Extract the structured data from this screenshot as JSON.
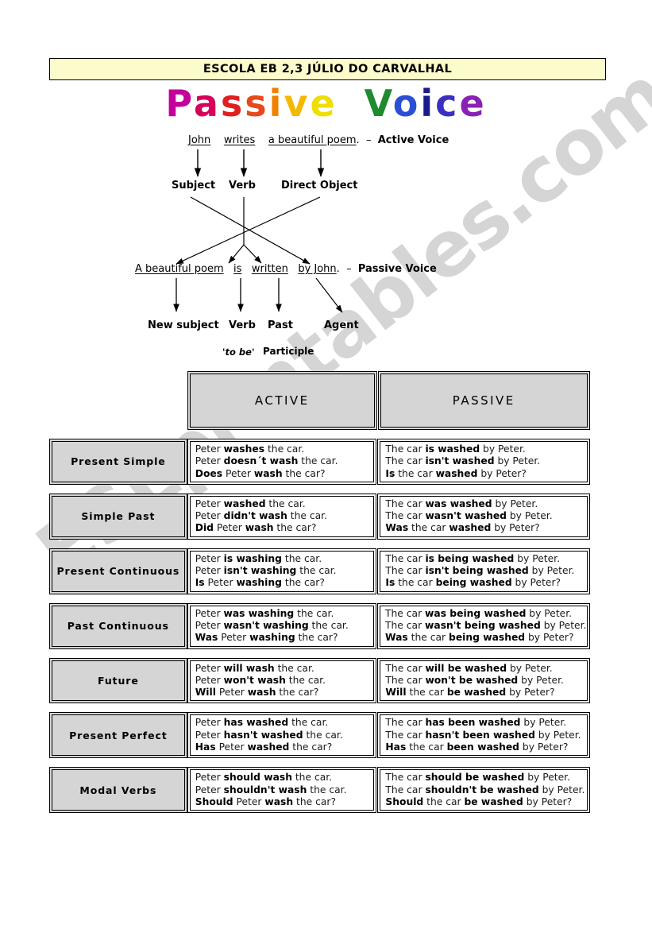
{
  "school_header": {
    "text": "ESCOLA EB 2,3 JÚLIO DO CARVALHAL"
  },
  "title": {
    "word1": "Passive",
    "word2": "Voice",
    "letters": [
      {
        "ch": "P",
        "color": "#C4009B"
      },
      {
        "ch": "a",
        "color": "#D6005B"
      },
      {
        "ch": "s",
        "color": "#E02020"
      },
      {
        "ch": "s",
        "color": "#E8491C"
      },
      {
        "ch": "i",
        "color": "#F08000"
      },
      {
        "ch": "v",
        "color": "#F5B800"
      },
      {
        "ch": "e",
        "color": "#EDE000"
      },
      {
        "ch": "V",
        "color": "#1E8B2E"
      },
      {
        "ch": "o",
        "color": "#2A4FD6"
      },
      {
        "ch": "i",
        "color": "#1B1B8F"
      },
      {
        "ch": "c",
        "color": "#3A2FC0"
      },
      {
        "ch": "e",
        "color": "#8A21B5"
      }
    ]
  },
  "watermark": {
    "text": "ESLprintables.com"
  },
  "diagram": {
    "active_sentence": {
      "part1": "John",
      "part2": "writes",
      "part3": "a beautiful poem",
      "period": ".",
      "dash": "–",
      "voice_label": "Active Voice"
    },
    "active_labels": {
      "subject": "Subject",
      "verb": "Verb",
      "direct_object": "Direct Object"
    },
    "passive_sentence": {
      "part1": "A beautiful poem",
      "part2": "is",
      "part3": "written",
      "part4": "by John",
      "period": ".",
      "dash": "–",
      "voice_label": "Passive Voice"
    },
    "passive_labels": {
      "new_subject": "New subject",
      "verb": "Verb",
      "past": "Past",
      "agent": "Agent",
      "to_be": "'to be'",
      "participle": "Participle"
    }
  },
  "table": {
    "columns": {
      "active": "ACTIVE",
      "passive": "PASSIVE"
    },
    "rows": [
      {
        "label": "Present Simple",
        "active": [
          [
            {
              "t": "Peter ",
              "b": false
            },
            {
              "t": "washes",
              "b": true
            },
            {
              "t": " the car.",
              "b": false
            }
          ],
          [
            {
              "t": "Peter ",
              "b": false
            },
            {
              "t": "doesn´t wash",
              "b": true
            },
            {
              "t": " the car.",
              "b": false
            }
          ],
          [
            {
              "t": "Does",
              "b": true
            },
            {
              "t": " Peter ",
              "b": false
            },
            {
              "t": "wash",
              "b": true
            },
            {
              "t": " the car?",
              "b": false
            }
          ]
        ],
        "passive": [
          [
            {
              "t": "The car ",
              "b": false
            },
            {
              "t": "is washed",
              "b": true
            },
            {
              "t": " by Peter.",
              "b": false
            }
          ],
          [
            {
              "t": "The car ",
              "b": false
            },
            {
              "t": "isn't washed",
              "b": true
            },
            {
              "t": " by Peter.",
              "b": false
            }
          ],
          [
            {
              "t": "Is",
              "b": true
            },
            {
              "t": " the car ",
              "b": false
            },
            {
              "t": "washed",
              "b": true
            },
            {
              "t": " by Peter?",
              "b": false
            }
          ]
        ]
      },
      {
        "label": "Simple Past",
        "active": [
          [
            {
              "t": "Peter ",
              "b": false
            },
            {
              "t": "washed",
              "b": true
            },
            {
              "t": " the car.",
              "b": false
            }
          ],
          [
            {
              "t": "Peter ",
              "b": false
            },
            {
              "t": "didn't wash",
              "b": true
            },
            {
              "t": " the car.",
              "b": false
            }
          ],
          [
            {
              "t": "Did",
              "b": true
            },
            {
              "t": " Peter ",
              "b": false
            },
            {
              "t": "wash",
              "b": true
            },
            {
              "t": " the car?",
              "b": false
            }
          ]
        ],
        "passive": [
          [
            {
              "t": "The car ",
              "b": false
            },
            {
              "t": "was washed",
              "b": true
            },
            {
              "t": " by Peter.",
              "b": false
            }
          ],
          [
            {
              "t": "The car ",
              "b": false
            },
            {
              "t": "wasn't washed",
              "b": true
            },
            {
              "t": " by Peter.",
              "b": false
            }
          ],
          [
            {
              "t": "Was",
              "b": true
            },
            {
              "t": " the car ",
              "b": false
            },
            {
              "t": "washed",
              "b": true
            },
            {
              "t": " by Peter?",
              "b": false
            }
          ]
        ]
      },
      {
        "label": "Present Continuous",
        "active": [
          [
            {
              "t": "Peter ",
              "b": false
            },
            {
              "t": "is washing",
              "b": true
            },
            {
              "t": " the car.",
              "b": false
            }
          ],
          [
            {
              "t": "Peter ",
              "b": false
            },
            {
              "t": "isn't washing",
              "b": true
            },
            {
              "t": " the car.",
              "b": false
            }
          ],
          [
            {
              "t": "Is",
              "b": true
            },
            {
              "t": " Peter ",
              "b": false
            },
            {
              "t": "washing",
              "b": true
            },
            {
              "t": " the car?",
              "b": false
            }
          ]
        ],
        "passive": [
          [
            {
              "t": "The car ",
              "b": false
            },
            {
              "t": "is being washed",
              "b": true
            },
            {
              "t": " by Peter.",
              "b": false
            }
          ],
          [
            {
              "t": "The car ",
              "b": false
            },
            {
              "t": "isn't being washed",
              "b": true
            },
            {
              "t": " by Peter.",
              "b": false
            }
          ],
          [
            {
              "t": "Is",
              "b": true
            },
            {
              "t": " the car ",
              "b": false
            },
            {
              "t": "being washed",
              "b": true
            },
            {
              "t": " by Peter?",
              "b": false
            }
          ]
        ]
      },
      {
        "label": "Past Continuous",
        "active": [
          [
            {
              "t": "Peter ",
              "b": false
            },
            {
              "t": "was washing",
              "b": true
            },
            {
              "t": " the car.",
              "b": false
            }
          ],
          [
            {
              "t": "Peter ",
              "b": false
            },
            {
              "t": "wasn't washing",
              "b": true
            },
            {
              "t": " the car.",
              "b": false
            }
          ],
          [
            {
              "t": "Was",
              "b": true
            },
            {
              "t": " Peter ",
              "b": false
            },
            {
              "t": "washing",
              "b": true
            },
            {
              "t": " the car?",
              "b": false
            }
          ]
        ],
        "passive": [
          [
            {
              "t": "The car ",
              "b": false
            },
            {
              "t": "was being washed",
              "b": true
            },
            {
              "t": " by Peter.",
              "b": false
            }
          ],
          [
            {
              "t": "The car ",
              "b": false
            },
            {
              "t": "wasn't being washed",
              "b": true
            },
            {
              "t": " by Peter.",
              "b": false
            }
          ],
          [
            {
              "t": "Was",
              "b": true
            },
            {
              "t": " the car ",
              "b": false
            },
            {
              "t": "being washed",
              "b": true
            },
            {
              "t": " by Peter?",
              "b": false
            }
          ]
        ]
      },
      {
        "label": "Future",
        "active": [
          [
            {
              "t": "Peter ",
              "b": false
            },
            {
              "t": "will wash",
              "b": true
            },
            {
              "t": " the car.",
              "b": false
            }
          ],
          [
            {
              "t": "Peter ",
              "b": false
            },
            {
              "t": "won't wash",
              "b": true
            },
            {
              "t": " the car.",
              "b": false
            }
          ],
          [
            {
              "t": "Will",
              "b": true
            },
            {
              "t": " Peter ",
              "b": false
            },
            {
              "t": "wash",
              "b": true
            },
            {
              "t": " the car?",
              "b": false
            }
          ]
        ],
        "passive": [
          [
            {
              "t": "The car ",
              "b": false
            },
            {
              "t": "will be washed",
              "b": true
            },
            {
              "t": " by Peter.",
              "b": false
            }
          ],
          [
            {
              "t": "The car ",
              "b": false
            },
            {
              "t": "won't be washed",
              "b": true
            },
            {
              "t": " by Peter.",
              "b": false
            }
          ],
          [
            {
              "t": "Will",
              "b": true
            },
            {
              "t": " the car ",
              "b": false
            },
            {
              "t": "be washed",
              "b": true
            },
            {
              "t": " by Peter?",
              "b": false
            }
          ]
        ]
      },
      {
        "label": "Present Perfect",
        "active": [
          [
            {
              "t": "Peter ",
              "b": false
            },
            {
              "t": "has washed",
              "b": true
            },
            {
              "t": " the car.",
              "b": false
            }
          ],
          [
            {
              "t": "Peter ",
              "b": false
            },
            {
              "t": "hasn't washed",
              "b": true
            },
            {
              "t": " the car.",
              "b": false
            }
          ],
          [
            {
              "t": "Has",
              "b": true
            },
            {
              "t": " Peter ",
              "b": false
            },
            {
              "t": "washed",
              "b": true
            },
            {
              "t": " the car?",
              "b": false
            }
          ]
        ],
        "passive": [
          [
            {
              "t": "The car ",
              "b": false
            },
            {
              "t": "has been washed",
              "b": true
            },
            {
              "t": " by Peter.",
              "b": false
            }
          ],
          [
            {
              "t": "The car ",
              "b": false
            },
            {
              "t": "hasn't been washed",
              "b": true
            },
            {
              "t": " by Peter.",
              "b": false
            }
          ],
          [
            {
              "t": "Has",
              "b": true
            },
            {
              "t": " the car ",
              "b": false
            },
            {
              "t": "been washed",
              "b": true
            },
            {
              "t": " by Peter?",
              "b": false
            }
          ]
        ]
      },
      {
        "label": "Modal Verbs",
        "active": [
          [
            {
              "t": "Peter ",
              "b": false
            },
            {
              "t": "should wash",
              "b": true
            },
            {
              "t": " the car.",
              "b": false
            }
          ],
          [
            {
              "t": "Peter ",
              "b": false
            },
            {
              "t": "shouldn't wash",
              "b": true
            },
            {
              "t": " the car.",
              "b": false
            }
          ],
          [
            {
              "t": "Should",
              "b": true
            },
            {
              "t": " Peter ",
              "b": false
            },
            {
              "t": "wash",
              "b": true
            },
            {
              "t": " the car?",
              "b": false
            }
          ]
        ],
        "passive": [
          [
            {
              "t": "The car ",
              "b": false
            },
            {
              "t": "should be washed",
              "b": true
            },
            {
              "t": " by Peter.",
              "b": false
            }
          ],
          [
            {
              "t": "The car ",
              "b": false
            },
            {
              "t": "shouldn't be washed",
              "b": true
            },
            {
              "t": " by Peter.",
              "b": false
            }
          ],
          [
            {
              "t": "Should",
              "b": true
            },
            {
              "t": " the car ",
              "b": false
            },
            {
              "t": "be washed",
              "b": true
            },
            {
              "t": " by Peter?",
              "b": false
            }
          ]
        ]
      }
    ]
  }
}
